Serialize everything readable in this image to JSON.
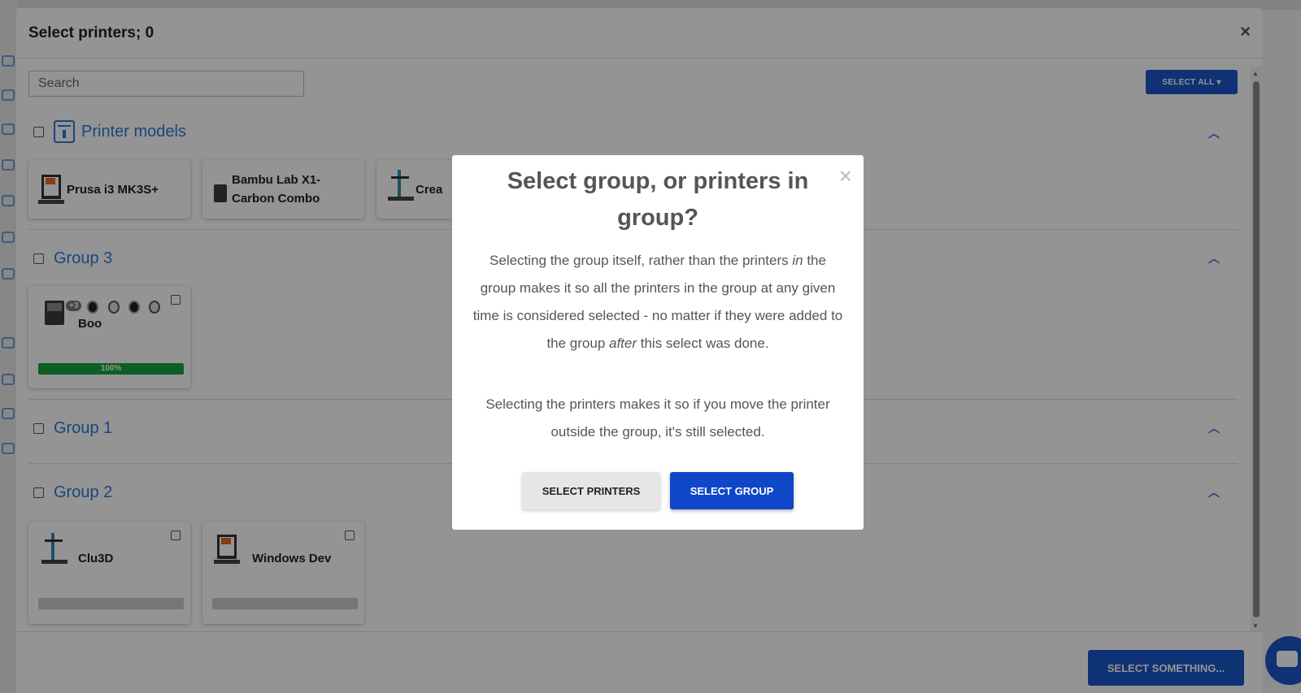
{
  "outer_modal": {
    "title": "Select printers; 0",
    "close_glyph": "×",
    "search": {
      "placeholder": "Search",
      "value": ""
    },
    "select_all_label": "SELECT ALL ▾",
    "footer_button_label": "SELECT SOMETHING..."
  },
  "sections": {
    "models": {
      "title": "Printer models",
      "cards": [
        {
          "name": "Prusa i3 MK3S+"
        },
        {
          "name": "Bambu Lab X1-Carbon Combo"
        },
        {
          "name": "Crea"
        }
      ]
    },
    "group3": {
      "title": "Group 3",
      "printer": {
        "name": "Boo",
        "badge": "+3",
        "progress_label": "100%",
        "progress": 1.0
      }
    },
    "group1": {
      "title": "Group 1"
    },
    "group2": {
      "title": "Group 2",
      "printers": [
        {
          "name": "Clu3D"
        },
        {
          "name": "Windows Dev"
        }
      ]
    }
  },
  "dialog": {
    "title": "Select group, or printers in group?",
    "close_glyph": "×",
    "p1_before": "Selecting the group itself, rather than the printers ",
    "p1_em1": "in",
    "p1_middle": " the group makes it so all the printers in the group at any given time is considered selected - no matter if they were added to the group ",
    "p1_em2": "after",
    "p1_after": " this select was done.",
    "p2": "Selecting the printers makes it so if you move the printer outside the group, it's still selected.",
    "select_printers_label": "SELECT PRINTERS",
    "select_group_label": "SELECT GROUP"
  },
  "icons": {
    "chevron": "chevron-up-icon",
    "models": "printer-models-icon",
    "chat": "chat-icon"
  },
  "colors": {
    "accent": "#1a56c9",
    "link": "#2a7ad6",
    "progress": "#17a43f"
  }
}
